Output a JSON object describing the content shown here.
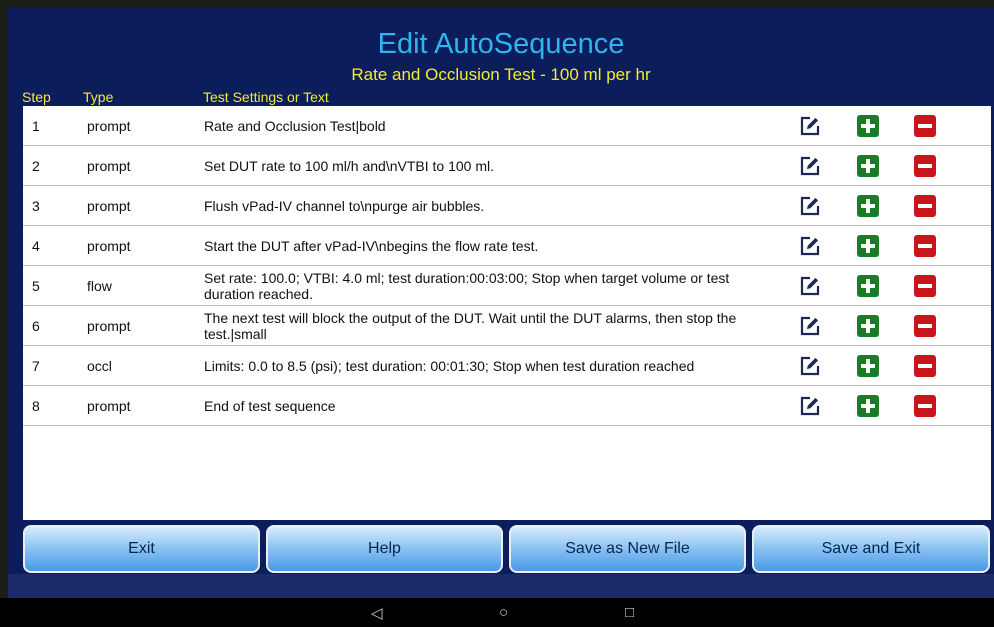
{
  "header": {
    "title": "Edit AutoSequence",
    "subtitle": "Rate and Occlusion Test - 100 ml per hr"
  },
  "columns": {
    "step": "Step",
    "type": "Type",
    "settings": "Test Settings or Text"
  },
  "rows": [
    {
      "step": "1",
      "type": "prompt",
      "text": "Rate and Occlusion Test|bold"
    },
    {
      "step": "2",
      "type": "prompt",
      "text": "Set DUT rate to 100 ml/h and\\nVTBI to 100 ml."
    },
    {
      "step": "3",
      "type": "prompt",
      "text": "Flush vPad-IV channel to\\npurge air bubbles."
    },
    {
      "step": "4",
      "type": "prompt",
      "text": "Start the DUT after vPad-IV\\nbegins the flow rate test."
    },
    {
      "step": "5",
      "type": "flow",
      "text": "Set rate: 100.0; VTBI: 4.0 ml; test duration:00:03:00; Stop when target volume or test duration reached."
    },
    {
      "step": "6",
      "type": "prompt",
      "text": "The next test will block the output of the DUT. Wait until the DUT alarms, then stop the test.|small"
    },
    {
      "step": "7",
      "type": "occl",
      "text": "Limits: 0.0 to 8.5 (psi); test duration: 00:01:30; Stop when test duration reached"
    },
    {
      "step": "8",
      "type": "prompt",
      "text": "End of test sequence"
    }
  ],
  "buttons": {
    "exit": "Exit",
    "help": "Help",
    "save_new": "Save as New File",
    "save_exit": "Save and Exit"
  },
  "navbar": {
    "back": "◁",
    "home": "○",
    "recents": "□"
  },
  "colors": {
    "background": "#0c1d5c",
    "title": "#2fb4f0",
    "subtitle": "#f2ec2a",
    "add": "#1a7a25",
    "delete": "#c8171c"
  },
  "icons": {
    "edit": "edit-icon",
    "add": "add-icon",
    "delete": "delete-icon"
  }
}
